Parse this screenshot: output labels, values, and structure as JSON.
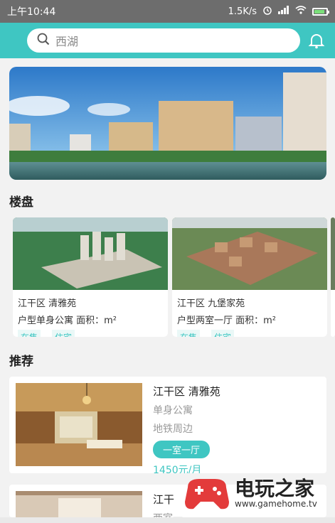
{
  "status_bar": {
    "time": "上午10:44",
    "speed": "1.5K/s",
    "battery_level": 0.9
  },
  "header": {
    "search_placeholder": "西湖",
    "accent_color": "#3fc6c2"
  },
  "sections": {
    "properties_title": "楼盘",
    "recommend_title": "推荐"
  },
  "properties": [
    {
      "location": "江干区 清雅苑",
      "detail": "户型单身公寓 面积：m²",
      "tags": [
        "在售",
        "住宅"
      ]
    },
    {
      "location": "江干区 九堡家苑",
      "detail": "户型两室一厅 面积：m²",
      "tags": [
        "在售",
        "住宅"
      ]
    }
  ],
  "recommendations": [
    {
      "title": "江干区 清雅苑",
      "type": "单身公寓",
      "feature": "地铁周边",
      "layout": "一室一厅",
      "price": "1450元/月"
    },
    {
      "title": "江干",
      "type": "两室一"
    }
  ],
  "watermark": {
    "name": "电玩之家",
    "url": "www.gamehome.tv"
  },
  "icons": [
    "search-icon",
    "bell-icon",
    "wifi-icon",
    "signal-icon",
    "alarm-icon",
    "battery-icon"
  ]
}
